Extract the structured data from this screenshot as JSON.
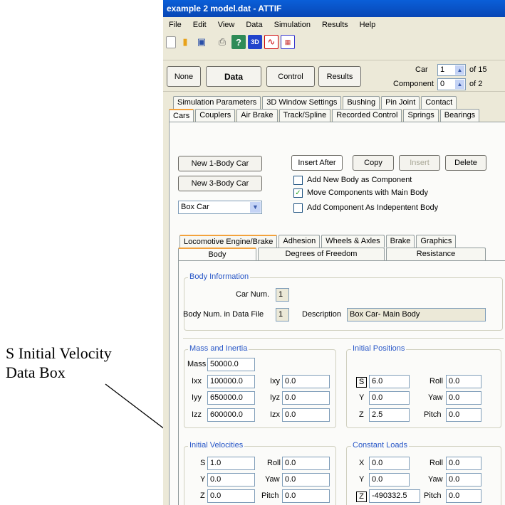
{
  "annotation": {
    "text": "S Initial Velocity\nData Box"
  },
  "window": {
    "title": "example 2 model.dat - ATTIF"
  },
  "menu": [
    "File",
    "Edit",
    "View",
    "Data",
    "Simulation",
    "Results",
    "Help"
  ],
  "toolbar_icons": [
    "new-file-icon",
    "open-file-icon",
    "save-icon",
    "print-icon",
    "help-icon",
    "3d-view-icon",
    "chart-icon",
    "data-grid-icon"
  ],
  "mode_buttons": {
    "none": "None",
    "data": "Data",
    "control": "Control",
    "results": "Results"
  },
  "car_selector": {
    "car_label": "Car",
    "car_value": "1",
    "car_of": "of 15",
    "component_label": "Component",
    "component_value": "0",
    "component_of": "of 2"
  },
  "tabs_row1": [
    "Simulation Parameters",
    "3D Window Settings",
    "Bushing",
    "Pin Joint",
    "Contact"
  ],
  "tabs_row2": [
    "Cars",
    "Couplers",
    "Air Brake",
    "Track/Spline",
    "Recorded Control",
    "Springs",
    "Bearings"
  ],
  "cars_panel": {
    "new_1body": "New 1-Body Car",
    "new_3body": "New 3-Body Car",
    "car_type": "Box Car",
    "insert_after": "Insert After",
    "copy": "Copy",
    "insert": "Insert",
    "delete": "Delete",
    "opt_add_component": "Add New Body as Component",
    "opt_move_components": "Move Components with Main Body",
    "opt_add_independent": "Add Component As Indepentent Body"
  },
  "subtabs_row1": [
    "Locomotive Engine/Brake",
    "Adhesion",
    "Wheels & Axles",
    "Brake",
    "Graphics"
  ],
  "subtabs_row2": [
    "Body",
    "Degrees of Freedom",
    "Resistance"
  ],
  "body_info": {
    "title": "Body Information",
    "car_num_label": "Car Num.",
    "car_num": "1",
    "body_num_label": "Body Num. in Data File",
    "body_num": "1",
    "desc_label": "Description",
    "desc": "Box Car- Main Body"
  },
  "mass": {
    "title": "Mass and Inertia",
    "mass_label": "Mass",
    "mass": "50000.0",
    "ixx_label": "Ixx",
    "ixx": "100000.0",
    "ixy_label": "Ixy",
    "ixy": "0.0",
    "iyy_label": "Iyy",
    "iyy": "650000.0",
    "iyz_label": "Iyz",
    "iyz": "0.0",
    "izz_label": "Izz",
    "izz": "600000.0",
    "izx_label": "Izx",
    "izx": "0.0"
  },
  "init_pos": {
    "title": "Initial Positions",
    "s_label": "S",
    "s": "6.0",
    "roll_label": "Roll",
    "roll": "0.0",
    "y_label": "Y",
    "y": "0.0",
    "yaw_label": "Yaw",
    "yaw": "0.0",
    "z_label": "Z",
    "z": "2.5",
    "pitch_label": "Pitch",
    "pitch": "0.0"
  },
  "init_vel": {
    "title": "Initial Velocities",
    "s_label": "S",
    "s": "1.0",
    "roll_label": "Roll",
    "roll": "0.0",
    "y_label": "Y",
    "y": "0.0",
    "yaw_label": "Yaw",
    "yaw": "0.0",
    "z_label": "Z",
    "z": "0.0",
    "pitch_label": "Pitch",
    "pitch": "0.0"
  },
  "const_loads": {
    "title": "Constant Loads",
    "x_label": "X",
    "x": "0.0",
    "roll_label": "Roll",
    "roll": "0.0",
    "y_label": "Y",
    "y": "0.0",
    "yaw_label": "Yaw",
    "yaw": "0.0",
    "z_label": "Z",
    "z": "-490332.5",
    "pitch_label": "Pitch",
    "pitch": "0.0"
  }
}
